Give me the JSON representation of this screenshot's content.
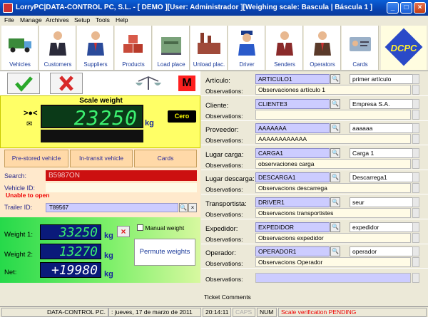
{
  "window": {
    "title": "LorryPC|DATA-CONTROL PC, S.L. - [ DEMO ][User: Administrador ][Weighing scale: Bascula | Báscula 1 ]"
  },
  "menu": [
    "File",
    "Manage",
    "Archives",
    "Setup",
    "Tools",
    "Help"
  ],
  "toolbar": [
    "Vehicles",
    "Customers",
    "Suppliers",
    "Products",
    "Load place",
    "Unload plac.",
    "Driver",
    "Senders",
    "Operators",
    "Cards"
  ],
  "logo": {
    "text": "DCPC"
  },
  "scale": {
    "title": "Scale weight",
    "reading": "23250",
    "unit": "kg",
    "zero_button": "Cero",
    "indicator": "M"
  },
  "vehicle_buttons": [
    "Pre-stored vehicle",
    "In-transit vehicle",
    "Cards"
  ],
  "fields": {
    "search_label": "Search:",
    "search_value": "B5987ON",
    "vehicle_id_label": "Vehicle ID:",
    "error": "Unable to open",
    "trailer_label": "Trailer ID:",
    "trailer_value": "T89567"
  },
  "weights": {
    "w1_label": "Weight 1:",
    "w1": "33250",
    "w2_label": "Weight 2:",
    "w2": "13270",
    "net_label": "Net:",
    "net": "+19980",
    "unit": "kg",
    "manual_label": "Manual weight",
    "permute_label": "Permute weights"
  },
  "sections": [
    {
      "label": "Artículo:",
      "code": "ARTICULO1",
      "desc": "primer artículo",
      "obs": "Observaciones artículo 1"
    },
    {
      "label": "Cliente:",
      "code": "CLIENTE3",
      "desc": "Empresa S.A.",
      "obs": ""
    },
    {
      "label": "Proveedor:",
      "code": "AAAAAAA",
      "desc": "aaaaaa",
      "obs": "AAAAAAAAAAAA"
    },
    {
      "label": "Lugar carga:",
      "code": "CARGA1",
      "desc": "Carga 1",
      "obs": "observaciones carga"
    },
    {
      "label": "Lugar descarga:",
      "code": "DESCARGA1",
      "desc": "Descarrega1",
      "obs": "Observacions descarrega"
    },
    {
      "label": "Transportista:",
      "code": "DRIVER1",
      "desc": "seur",
      "obs": "Observacions transportistes"
    },
    {
      "label": "Expedidor:",
      "code": "EXPEDIDOR",
      "desc": "expedidor",
      "obs": "Observacions expedidor"
    },
    {
      "label": "Operador:",
      "code": "OPERADOR1",
      "desc": "operador",
      "obs": "Observacions Operador"
    }
  ],
  "obs_label": "Observations:",
  "extra_obs_label": "Observations:",
  "ticket_comments": "Ticket Comments",
  "status": {
    "company": "DATA-CONTROL PC.",
    "date": ": jueves, 17 de marzo de 2011",
    "time": "20:14:11",
    "caps": "CAPS",
    "num": "NUM",
    "message": "Scale verification PENDING"
  }
}
